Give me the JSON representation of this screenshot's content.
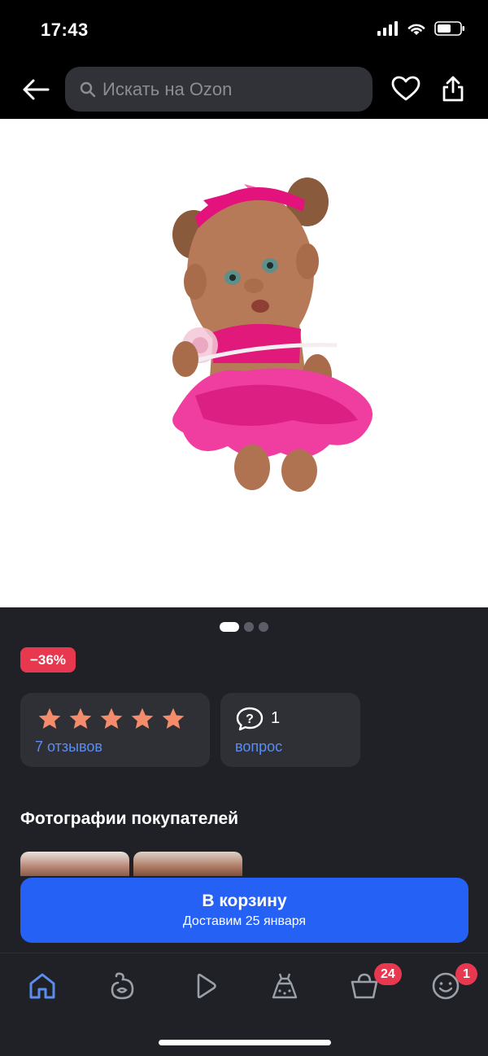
{
  "status_bar": {
    "time": "17:43"
  },
  "search": {
    "placeholder": "Искать на Ozon"
  },
  "product": {
    "image_name": "doll-photo",
    "carousel_count": 3,
    "carousel_active": 1
  },
  "discount": {
    "label": "−36%"
  },
  "rating": {
    "stars": 5,
    "reviews_label": "7 отзывов"
  },
  "questions": {
    "count": "1",
    "label": "вопрос"
  },
  "photos_section": {
    "title": "Фотографии покупателей"
  },
  "cart": {
    "label": "В корзину",
    "delivery": "Доставим 25 января"
  },
  "nav": {
    "items": [
      {
        "name": "home",
        "icon": "home-icon",
        "active": true
      },
      {
        "name": "fresh",
        "icon": "fresh-icon"
      },
      {
        "name": "video",
        "icon": "play-icon"
      },
      {
        "name": "fashion",
        "icon": "dress-icon"
      },
      {
        "name": "cart",
        "icon": "basket-icon",
        "badge": "24"
      },
      {
        "name": "profile",
        "icon": "profile-icon",
        "badge": "1"
      }
    ]
  },
  "colors": {
    "accent": "#2561f5",
    "discount": "#e8384f",
    "star": "#f48b6b",
    "link": "#5b8def"
  }
}
